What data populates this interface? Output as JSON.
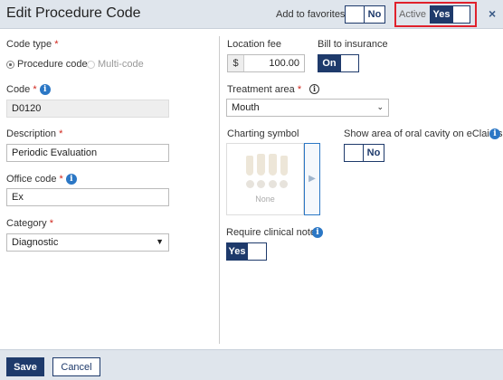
{
  "header": {
    "title": "Edit Procedure Code",
    "favorites_label": "Add to favorites",
    "favorites_value": "No",
    "active_label": "Active",
    "active_value": "Yes",
    "close_glyph": "×"
  },
  "left": {
    "code_type_label": "Code type",
    "code_type_options": [
      "Procedure code",
      "Multi-code"
    ],
    "code_label": "Code",
    "code_value": "D0120",
    "description_label": "Description",
    "description_value": "Periodic Evaluation",
    "office_code_label": "Office code",
    "office_code_value": "Ex",
    "category_label": "Category",
    "category_value": "Diagnostic"
  },
  "right": {
    "location_fee_label": "Location fee",
    "fee_prefix": "$",
    "fee_value": "100.00",
    "bill_label": "Bill to insurance",
    "bill_value": "On",
    "treatment_area_label": "Treatment area",
    "treatment_area_value": "Mouth",
    "charting_symbol_label": "Charting symbol",
    "charting_none": "None",
    "claims_label": "Show area of oral cavity on eClaims",
    "claims_value": "No",
    "clinical_note_label": "Require clinical note",
    "clinical_note_value": "Yes"
  },
  "footer": {
    "save_label": "Save",
    "cancel_label": "Cancel"
  },
  "required_mark": "*",
  "info_glyph": "i",
  "icons": {
    "info": "info-circle-icon",
    "info_outline": "info-outline-icon",
    "close": "close-icon",
    "caret": "chevron-down-icon",
    "next": "chevron-right-icon"
  },
  "colors": {
    "primary": "#1e3a6b",
    "info": "#2b77c5",
    "required": "#d0261c",
    "highlight": "#e0212c",
    "header_bg": "#dfe5ec"
  }
}
